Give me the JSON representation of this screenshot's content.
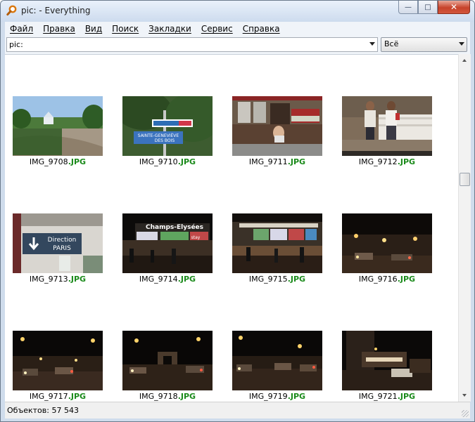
{
  "window": {
    "title": "pic: - Everything"
  },
  "menubar": {
    "items": [
      "Файл",
      "Правка",
      "Вид",
      "Поиск",
      "Закладки",
      "Сервис",
      "Справка"
    ]
  },
  "search": {
    "value": "pic:",
    "filter": "Всё"
  },
  "thumbnails": [
    {
      "name": "IMG_9708",
      "ext": ".JPG"
    },
    {
      "name": "IMG_9710",
      "ext": ".JPG"
    },
    {
      "name": "IMG_9711",
      "ext": ".JPG"
    },
    {
      "name": "IMG_9712",
      "ext": ".JPG"
    },
    {
      "name": "IMG_9713",
      "ext": ".JPG"
    },
    {
      "name": "IMG_9714",
      "ext": ".JPG"
    },
    {
      "name": "IMG_9715",
      "ext": ".JPG"
    },
    {
      "name": "IMG_9716",
      "ext": ".JPG"
    },
    {
      "name": "IMG_9717",
      "ext": ".JPG"
    },
    {
      "name": "IMG_9718",
      "ext": ".JPG"
    },
    {
      "name": "IMG_9719",
      "ext": ".JPG"
    },
    {
      "name": "IMG_9721",
      "ext": ".JPG"
    }
  ],
  "photo_text": {
    "sign_1": "SAINTE-GENEVIÈVE",
    "sign_2": "DES BOIS",
    "direction_1": "Direction",
    "direction_2": "PARIS",
    "champs": "Champs-Elysées",
    "store_sign": "stay"
  },
  "status": {
    "objects": "Объектов: 57 543"
  },
  "colors": {
    "accent_ext": "#1a8a1a",
    "close_button": "#c7432b"
  }
}
